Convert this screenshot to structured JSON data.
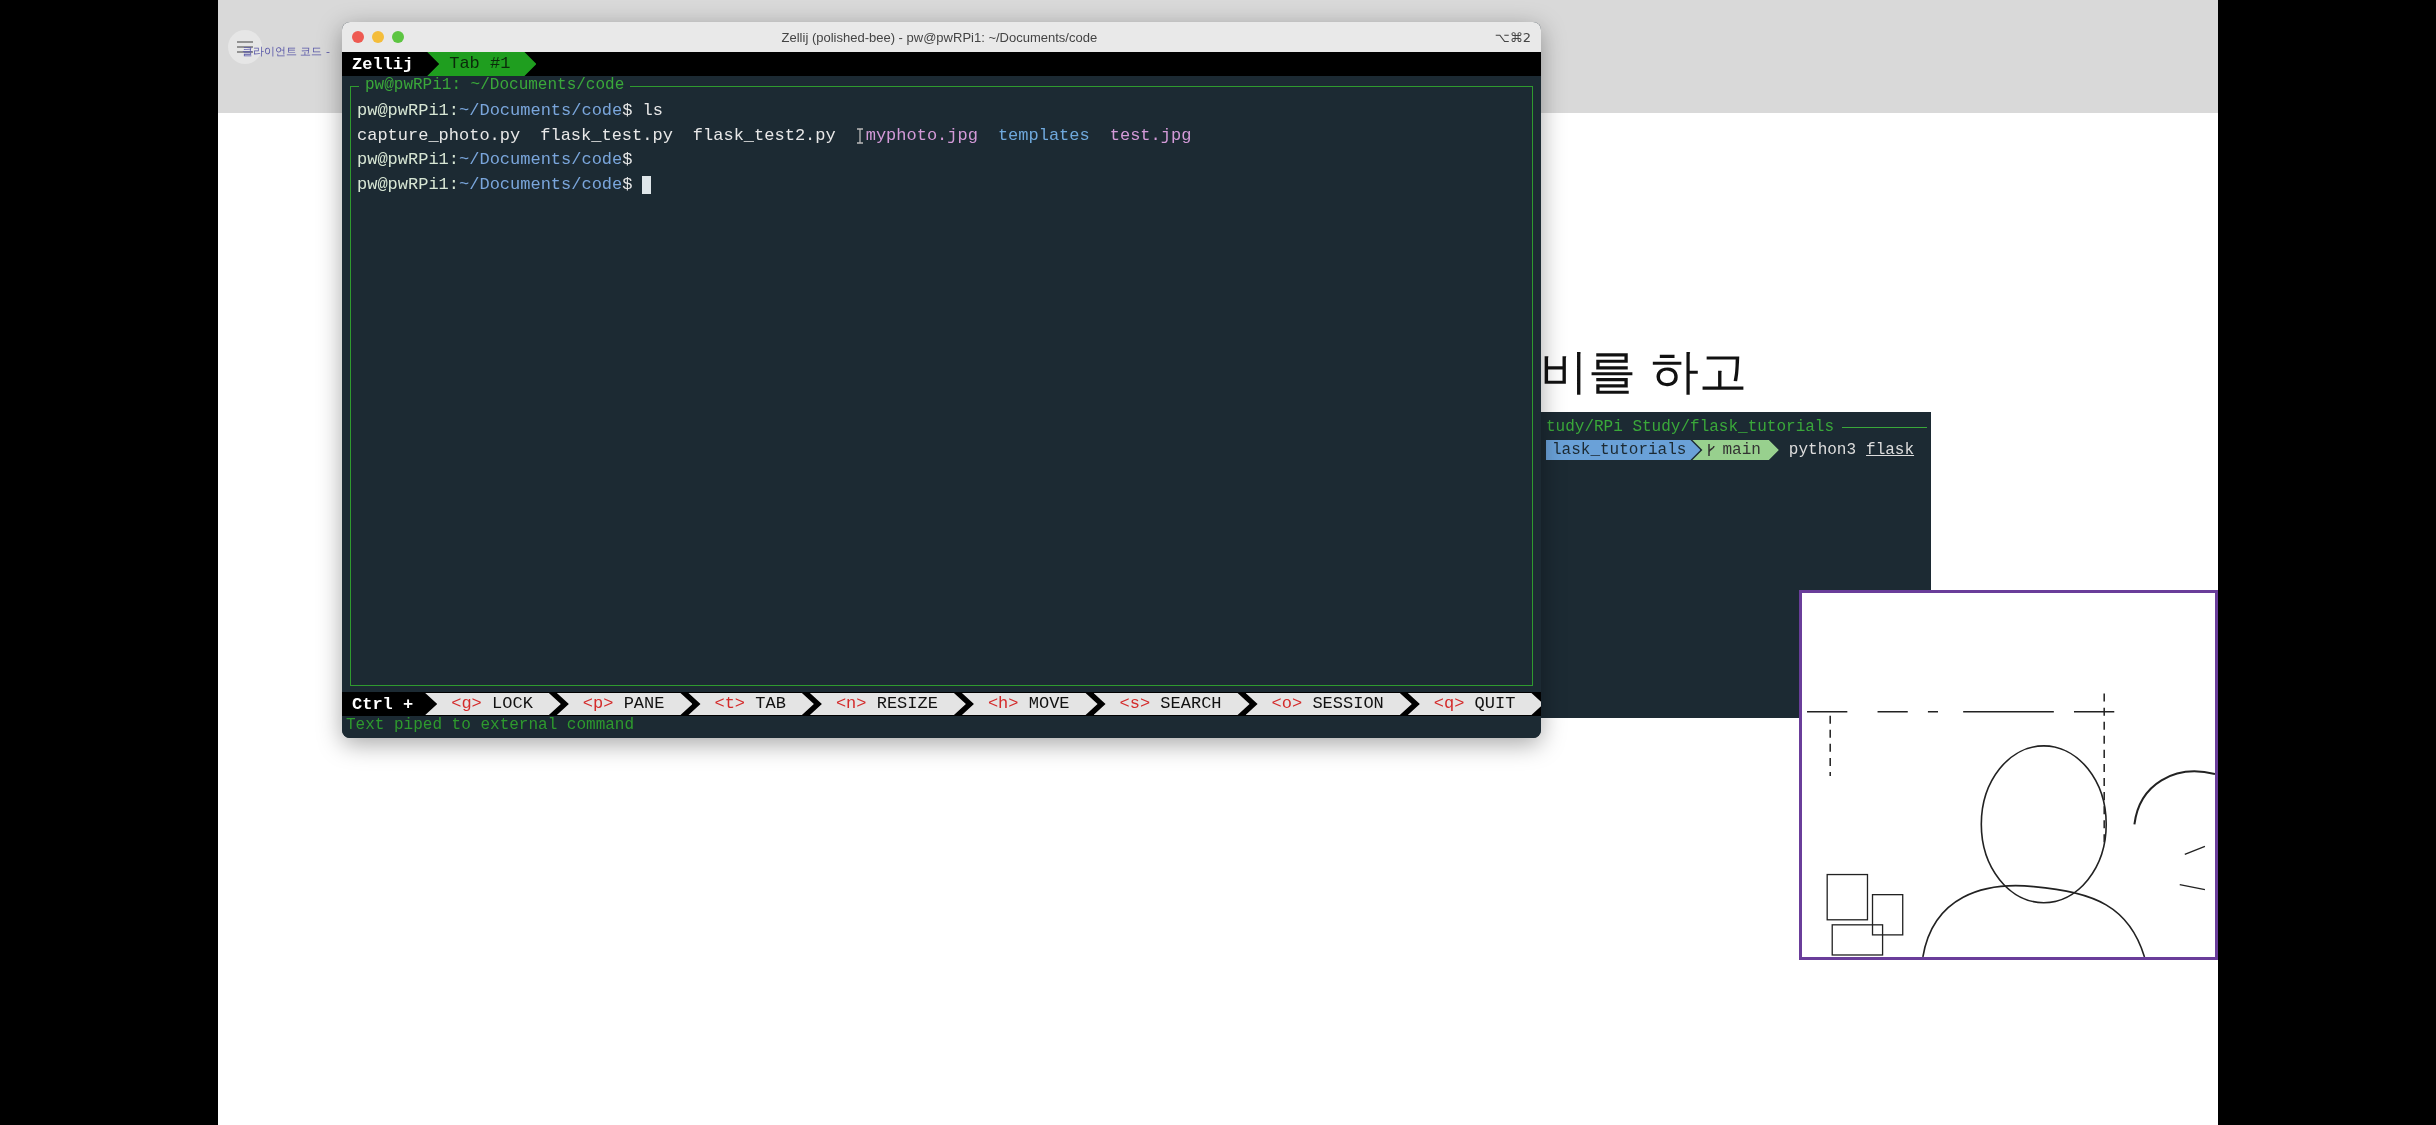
{
  "page": {
    "menu_label": "클라이언트 코드 -",
    "heading": "비를 하고",
    "snippet": {
      "title": "tudy/RPi Study/flask_tutorials",
      "folder": "lask_tutorials",
      "branch": "main",
      "command": "python3",
      "argument": "flask"
    }
  },
  "window": {
    "title": "Zellij (polished-bee) - pw@pwRPi1: ~/Documents/code",
    "shortcut": "⌥⌘2"
  },
  "tab_bar": {
    "app": "Zellij",
    "tabs": [
      {
        "label": "Tab #1",
        "selected": true
      }
    ]
  },
  "pane": {
    "title": "pw@pwRPi1: ~/Documents/code",
    "lines": [
      {
        "kind": "prompt",
        "user": "pw@pwRPi1:",
        "path": "~/Documents/code",
        "symbol": "$",
        "command": "ls",
        "cursor": false
      },
      {
        "kind": "listing",
        "entries": [
          {
            "name": "capture_photo.py",
            "color": "#e8e8e8"
          },
          {
            "name": "flask_test.py",
            "color": "#e8e8e8"
          },
          {
            "name": "flask_test2.py",
            "color": "#e8e8e8"
          },
          {
            "name": "myphoto.jpg",
            "color": "#d39ad8"
          },
          {
            "name": "templates",
            "color": "#6fa8dc"
          },
          {
            "name": "test.jpg",
            "color": "#d39ad8"
          }
        ]
      },
      {
        "kind": "prompt",
        "user": "pw@pwRPi1:",
        "path": "~/Documents/code",
        "symbol": "$",
        "cursor": false
      },
      {
        "kind": "prompt",
        "user": "pw@pwRPi1:",
        "path": "~/Documents/code",
        "symbol": "$",
        "cursor": true
      }
    ]
  },
  "keybar": {
    "modifier": "Ctrl +",
    "keys": [
      {
        "key": "<g>",
        "action": "LOCK"
      },
      {
        "key": "<p>",
        "action": "PANE"
      },
      {
        "key": "<t>",
        "action": "TAB"
      },
      {
        "key": "<n>",
        "action": "RESIZE"
      },
      {
        "key": "<h>",
        "action": "MOVE"
      },
      {
        "key": "<s>",
        "action": "SEARCH"
      },
      {
        "key": "<o>",
        "action": "SESSION"
      },
      {
        "key": "<q>",
        "action": "QUIT"
      }
    ]
  },
  "status": "Text piped to external command"
}
